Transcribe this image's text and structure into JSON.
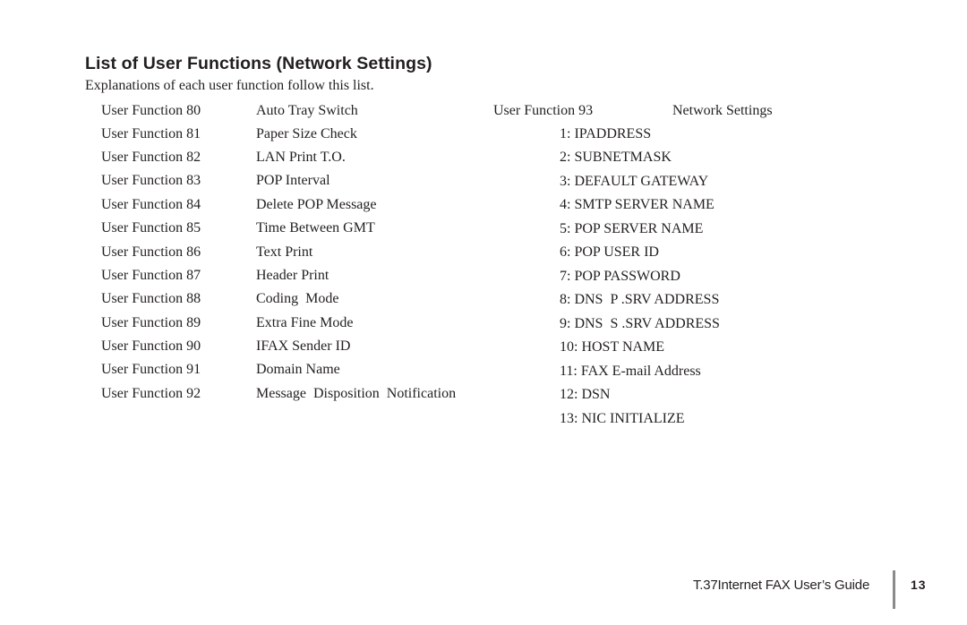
{
  "heading": {
    "title": "List of User Functions (Network Settings)",
    "intro": "Explanations of each user function follow this list."
  },
  "left_list": [
    {
      "function": "User Function 80",
      "name": "Auto Tray Switch"
    },
    {
      "function": "User Function 81",
      "name": "Paper Size Check"
    },
    {
      "function": "User Function 82",
      "name": "LAN Print T.O."
    },
    {
      "function": "User Function 83",
      "name": "POP Interval"
    },
    {
      "function": "User Function 84",
      "name": "Delete POP Message"
    },
    {
      "function": "User Function 85",
      "name": "Time Between GMT"
    },
    {
      "function": "User Function 86",
      "name": "Text Print"
    },
    {
      "function": "User Function 87",
      "name": "Header Print"
    },
    {
      "function": "User Function 88",
      "name": "Coding  Mode"
    },
    {
      "function": "User Function 89",
      "name": "Extra Fine Mode"
    },
    {
      "function": "User Function 90",
      "name": "IFAX Sender ID"
    },
    {
      "function": "User Function 91",
      "name": "Domain Name"
    },
    {
      "function": "User Function 92",
      "name": "Message  Disposition  Notification"
    }
  ],
  "right_list": {
    "function": "User Function 93",
    "name": "Network Settings",
    "subitems": [
      "1: IPADDRESS",
      "2: SUBNETMASK",
      "3: DEFAULT GATEWAY",
      "4: SMTP SERVER NAME",
      "5: POP SERVER NAME",
      "6: POP USER ID",
      "7: POP PASSWORD",
      "8: DNS  P .SRV ADDRESS",
      "9: DNS  S .SRV ADDRESS",
      "10: HOST NAME",
      "11: FAX E-mail Address",
      "12: DSN",
      "13: NIC INITIALIZE"
    ]
  },
  "footer": {
    "guide_title": "T.37Internet FAX User’s Guide",
    "page_number": "13"
  }
}
